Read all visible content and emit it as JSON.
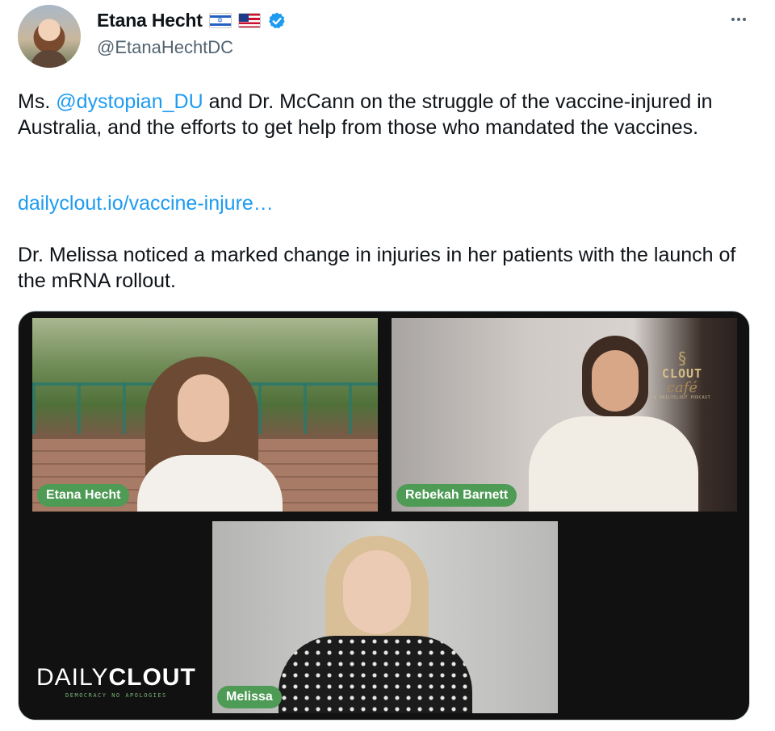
{
  "author": {
    "display_name": "Etana Hecht",
    "handle": "@EtanaHechtDC",
    "flags": [
      "israel-flag",
      "us-flag"
    ],
    "verified": true
  },
  "tweet": {
    "p1_prefix": "Ms. ",
    "p1_mention": "@dystopian_DU",
    "p1_suffix": " and Dr. McCann on the struggle of the vaccine-injured in Australia, and the efforts to get help from those who mandated the vaccines.",
    "link": "dailyclout.io/vaccine-injure…",
    "p3": "Dr. Melissa noticed a marked change in injuries in her patients with the launch of the mRNA rollout."
  },
  "media": {
    "participants": [
      {
        "name": "Etana Hecht"
      },
      {
        "name": "Rebekah Barnett"
      },
      {
        "name": "Melissa"
      }
    ],
    "clout_logo": {
      "line1": "CLOUT",
      "line2": "café",
      "line3": "A DAILYCLOUT PODCAST"
    },
    "daily_logo": {
      "regular": "DAILY",
      "bold": "CLOUT",
      "tagline": "DEMOCRACY NO APOLOGIES"
    }
  },
  "colors": {
    "link": "#1d9bf0",
    "name_tag": "#4e9b55",
    "verified": "#1d9bf0",
    "secondary_text": "#536471"
  }
}
